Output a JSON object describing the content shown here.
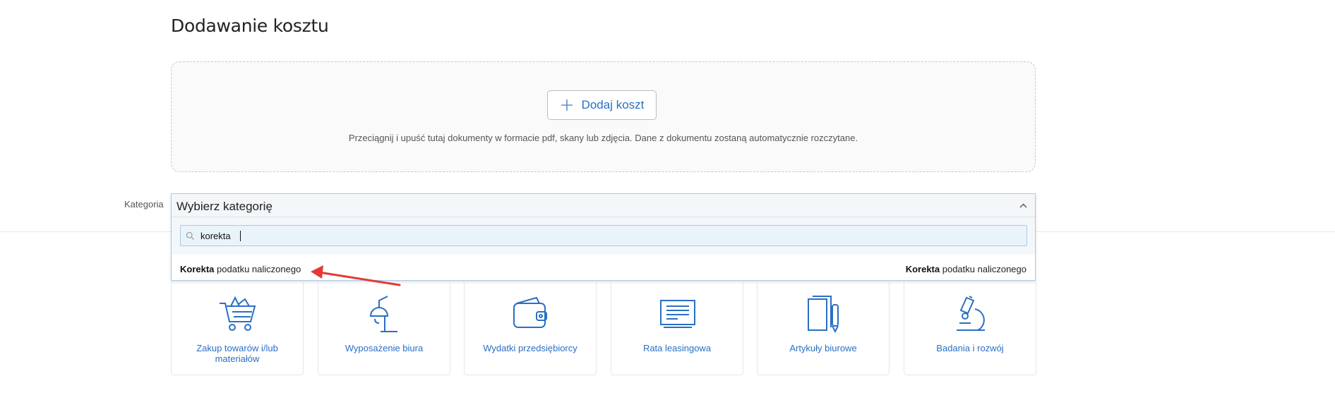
{
  "page": {
    "title": "Dodawanie kosztu"
  },
  "dropzone": {
    "add_button_label": "Dodaj koszt",
    "hint": "Przeciągnij i upuść tutaj dokumenty w formacie pdf, skany lub zdjęcia. Dane z dokumentu zostaną automatycznie rozczytane."
  },
  "category": {
    "label": "Kategoria",
    "selected": "Wybierz kategorię",
    "search_value": "korekta",
    "option": {
      "left_bold": "Korekta",
      "left_rest": " podatku naliczonego",
      "right_bold": "Korekta",
      "right_rest": " podatku naliczonego"
    }
  },
  "tiles": [
    {
      "icon": "shopping-cart-icon",
      "label": "Zakup towarów i/lub materiałów"
    },
    {
      "icon": "desk-lamp-icon",
      "label": "Wyposażenie biura"
    },
    {
      "icon": "wallet-icon",
      "label": "Wydatki przedsiębiorcy"
    },
    {
      "icon": "leasing-document-icon",
      "label": "Rata leasingowa"
    },
    {
      "icon": "office-supplies-icon",
      "label": "Artykuły biurowe"
    },
    {
      "icon": "microscope-icon",
      "label": "Badania i rozwój"
    }
  ],
  "colors": {
    "accent": "#2a6fc4",
    "annotation_arrow": "#e53935"
  }
}
